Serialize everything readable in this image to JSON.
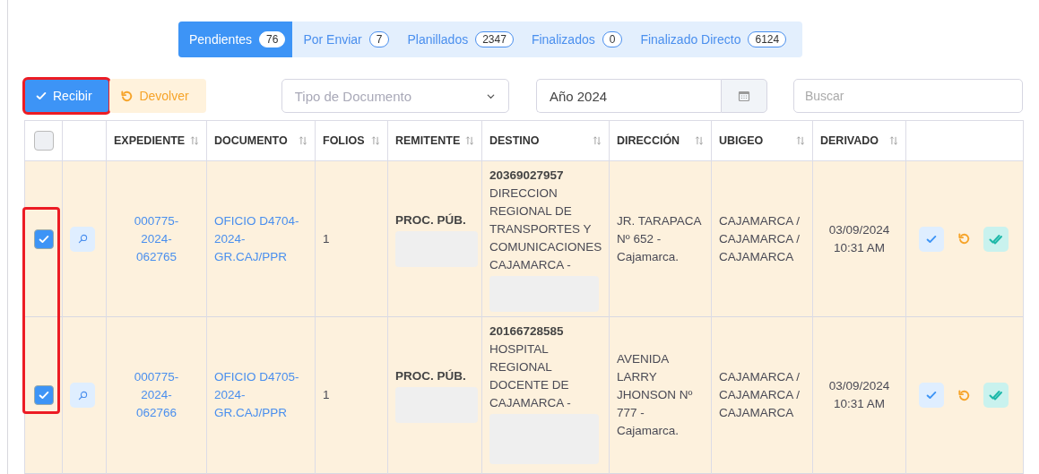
{
  "tabs": [
    {
      "label": "Pendientes",
      "count": "76",
      "selected": true
    },
    {
      "label": "Por Enviar",
      "count": "7",
      "selected": false
    },
    {
      "label": "Planillados",
      "count": "2347",
      "selected": false
    },
    {
      "label": "Finalizados",
      "count": "0",
      "selected": false
    },
    {
      "label": "Finalizado Directo",
      "count": "6124",
      "selected": false
    }
  ],
  "toolbar": {
    "buttons": [
      {
        "kind": "receive",
        "label": "Recibir",
        "highlighted": true
      },
      {
        "kind": "return",
        "label": "Devolver",
        "highlighted": false
      }
    ],
    "document_type": {
      "placeholder": "Tipo de Documento"
    },
    "year": {
      "value": "Año 2024"
    },
    "search": {
      "placeholder": "Buscar"
    }
  },
  "table": {
    "select_all_checked": false,
    "checkbox_column_highlighted": true,
    "columns": [
      {
        "label": "EXPEDIENTE",
        "sortable": true
      },
      {
        "label": "DOCUMENTO",
        "sortable": true
      },
      {
        "label": "FOLIOS",
        "sortable": true
      },
      {
        "label": "REMITENTE",
        "sortable": true
      },
      {
        "label": "DESTINO",
        "sortable": true
      },
      {
        "label": "DIRECCIÓN",
        "sortable": true
      },
      {
        "label": "UBIGEO",
        "sortable": true
      },
      {
        "label": "DERIVADO",
        "sortable": true
      }
    ],
    "rows": [
      {
        "checked": true,
        "expediente": "000775-\n2024-\n062765",
        "documento": "OFICIO D4704-\n2024-\nGR.CAJ/PPR",
        "folios": "1",
        "remitente": {
          "label": "PROC. PÚB.",
          "redacted": true
        },
        "destino": {
          "ruc": "20369027957",
          "name": "DIRECCION\nREGIONAL DE\nTRANSPORTES Y\nCOMUNICACIONES\nCAJAMARCA -",
          "redacted": true
        },
        "direccion": "JR. TARAPACA\nNº 652 -\nCajamarca.",
        "ubigeo": "CAJAMARCA /\nCAJAMARCA /\nCAJAMARCA",
        "derivado": "03/09/2024\n10:31 AM"
      },
      {
        "checked": true,
        "expediente": "000775-\n2024-\n062766",
        "documento": "OFICIO D4705-\n2024-\nGR.CAJ/PPR",
        "folios": "1",
        "remitente": {
          "label": "PROC. PÚB.",
          "redacted": true
        },
        "destino": {
          "ruc": "20166728585",
          "name": "HOSPITAL\nREGIONAL\nDOCENTE DE\nCAJAMARCA -",
          "redacted": true
        },
        "direccion": "AVENIDA\nLARRY\nJHONSON Nº\n777 -\nCajamarca.",
        "ubigeo": "CAJAMARCA /\nCAJAMARCA /\nCAJAMARCA",
        "derivado": "03/09/2024\n10:31 AM"
      }
    ]
  }
}
